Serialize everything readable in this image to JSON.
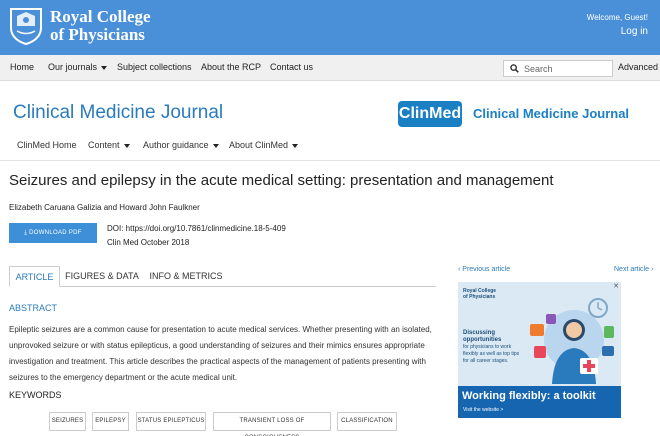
{
  "site": {
    "logo_text_line1": "Royal College",
    "logo_text_line2": "of Physicians",
    "welcome": "Welcome, Guest!",
    "login": "Log in"
  },
  "nav": {
    "items": [
      "Home",
      "Our journals",
      "Subject collections",
      "About the RCP",
      "Contact us"
    ],
    "search_placeholder": "Search",
    "advanced": "Advanced"
  },
  "journal": {
    "title": "Clinical Medicine Journal",
    "logo_text": "ClinMed",
    "logo_title": "Clinical Medicine Journal",
    "subnav": [
      "ClinMed Home",
      "Content",
      "Author guidance",
      "About ClinMed"
    ]
  },
  "article": {
    "title": "Seizures and epilepsy in the acute medical setting: presentation and management",
    "authors": "Elizabeth Caruana Galizia and Howard John Faulkner",
    "download_label": "DOWNLOAD PDF",
    "doi": "DOI: https://doi.org/10.7861/clinmedicine.18-5-409",
    "issue": "Clin Med October 2018",
    "tabs": [
      "ARTICLE",
      "FIGURES & DATA",
      "INFO & METRICS"
    ],
    "abstract_heading": "ABSTRACT",
    "abstract_text": "Epileptic seizures are a common cause for presentation to acute medical services. Whether presenting with an isolated, unprovoked seizure or with status epilepticus, a good understanding of seizures and their mimics ensures appropriate investigation and treatment. This article describes the practical aspects of the management of patients presenting with seizures to the emergency department or the acute medical unit.",
    "keywords_heading": "KEYWORDS",
    "keywords": [
      "SEIZURES",
      "EPILEPSY",
      "STATUS EPILEPTICUS",
      "TRANSIENT LOSS OF CONSCIOUSNESS",
      "CLASSIFICATION"
    ]
  },
  "sidebar": {
    "prev": "‹ Previous article",
    "next": "Next article ›",
    "ad": {
      "logo_line1": "Royal College",
      "logo_line2": "of Physicians",
      "lead": "Discussing opportunities",
      "body": "for physicians to work flexibly as well as top tips for all career stages.",
      "headline": "Working flexibly: a toolkit",
      "visit": "Visit the website >",
      "close": "✕"
    }
  },
  "colors": {
    "topbar": "#4a90d9",
    "accent": "#2a7bbd",
    "button": "#3d8fd8",
    "ad_bottom": "#1565b0"
  }
}
